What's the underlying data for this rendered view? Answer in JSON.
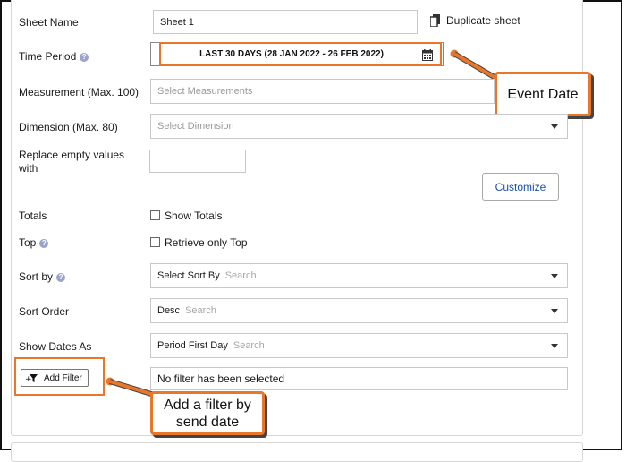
{
  "form": {
    "sheet_name_label": "Sheet Name",
    "sheet_name_value": "Sheet 1",
    "duplicate_label": "Duplicate sheet",
    "time_period_label": "Time Period",
    "time_period_value": "LAST 30 DAYS (28 JAN 2022 - 26 FEB 2022)",
    "measurement_label": "Measurement (Max. 100)",
    "measurement_placeholder": "Select Measurements",
    "dimension_label": "Dimension (Max. 80)",
    "dimension_placeholder": "Select Dimension",
    "replace_empty_label_line1": "Replace empty values",
    "replace_empty_label_line2": "with",
    "customize_label": "Customize",
    "totals_label": "Totals",
    "show_totals_label": "Show Totals",
    "top_label": "Top",
    "retrieve_top_label": "Retrieve only Top",
    "sort_by_label": "Sort by",
    "sort_by_value": "Select Sort By",
    "sort_order_label": "Sort Order",
    "sort_order_value": "Desc",
    "show_dates_label": "Show Dates As",
    "show_dates_value": "Period First Day",
    "search_placeholder": "Search",
    "add_filter_label": "Add Filter",
    "filter_status": "No filter has been selected"
  },
  "annotations": {
    "event_date": "Event Date",
    "add_filter_line1": "Add a filter by",
    "add_filter_line2": "send date",
    "accent_color": "#e8762b"
  },
  "icons": [
    "duplicate-icon",
    "calendar-icon",
    "help-icon",
    "filter-icon",
    "chevron-down-icon"
  ]
}
